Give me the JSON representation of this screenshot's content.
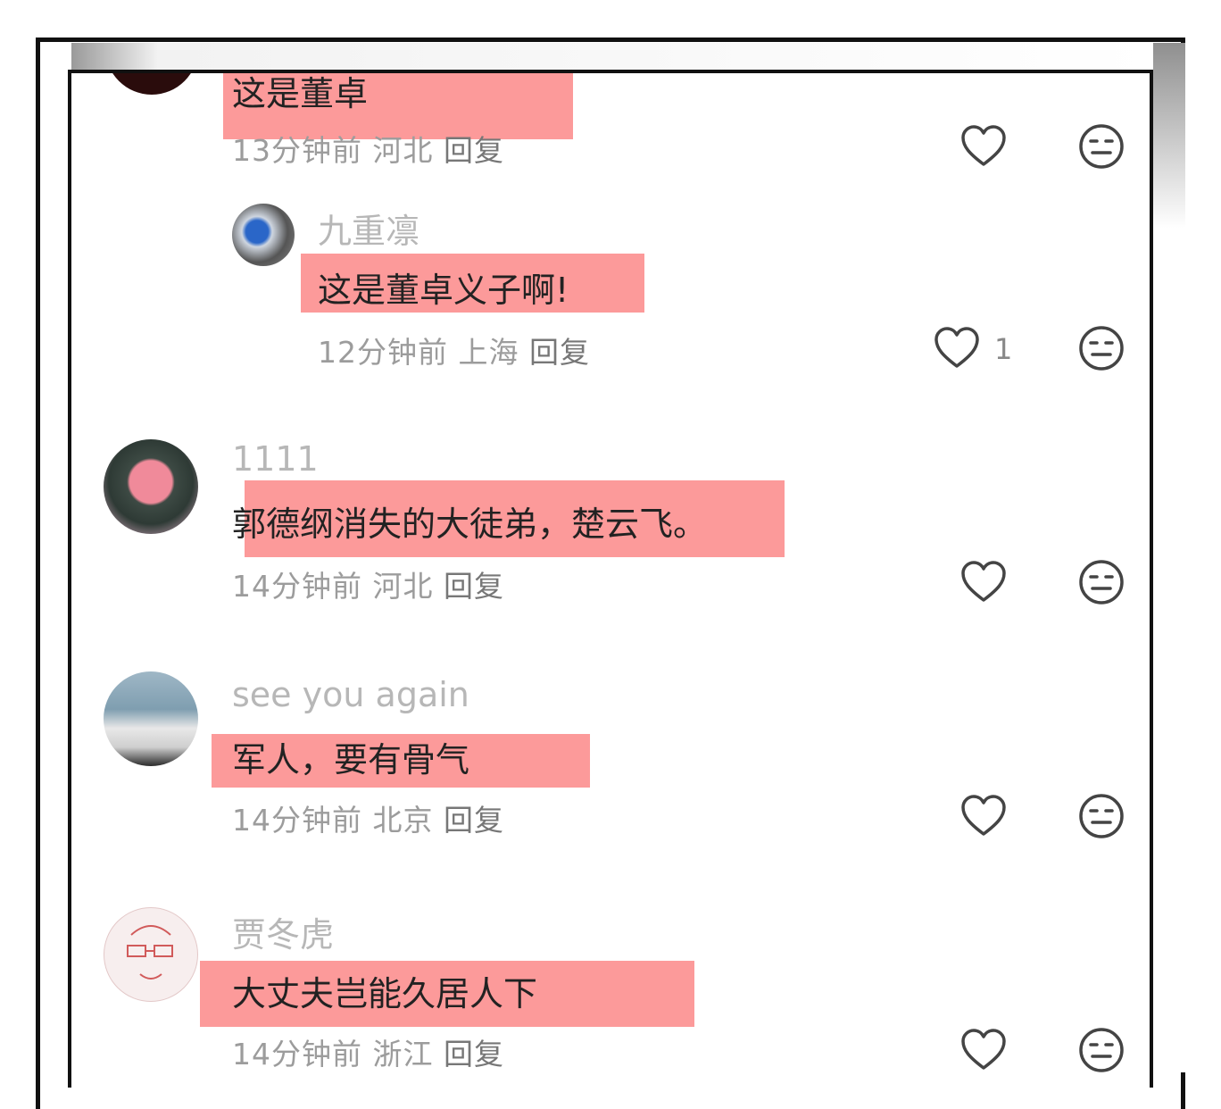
{
  "comments": [
    {
      "username": "",
      "text": "这是董卓",
      "time": "13分钟前",
      "location": "河北",
      "reply": "回复",
      "likes": ""
    },
    {
      "username": "九重凛",
      "text": "这是董卓义子啊!",
      "time": "12分钟前",
      "location": "上海",
      "reply": "回复",
      "likes": "1"
    },
    {
      "username": "1111",
      "text": "郭德纲消失的大徒弟，楚云飞。",
      "time": "14分钟前",
      "location": "河北",
      "reply": "回复",
      "likes": ""
    },
    {
      "username": "see you again",
      "text": "军人，要有骨气",
      "time": "14分钟前",
      "location": "北京",
      "reply": "回复",
      "likes": ""
    },
    {
      "username": "贾冬虎",
      "text": "大丈夫岂能久居人下",
      "time": "14分钟前",
      "location": "浙江",
      "reply": "回复",
      "likes": ""
    }
  ],
  "colors": {
    "highlight": "#fc9a9a",
    "meta_text": "#9c9c9c",
    "username": "#b7b7b7"
  },
  "icons": {
    "like": "heart-outline-icon",
    "dislike": "neutral-face-icon"
  }
}
